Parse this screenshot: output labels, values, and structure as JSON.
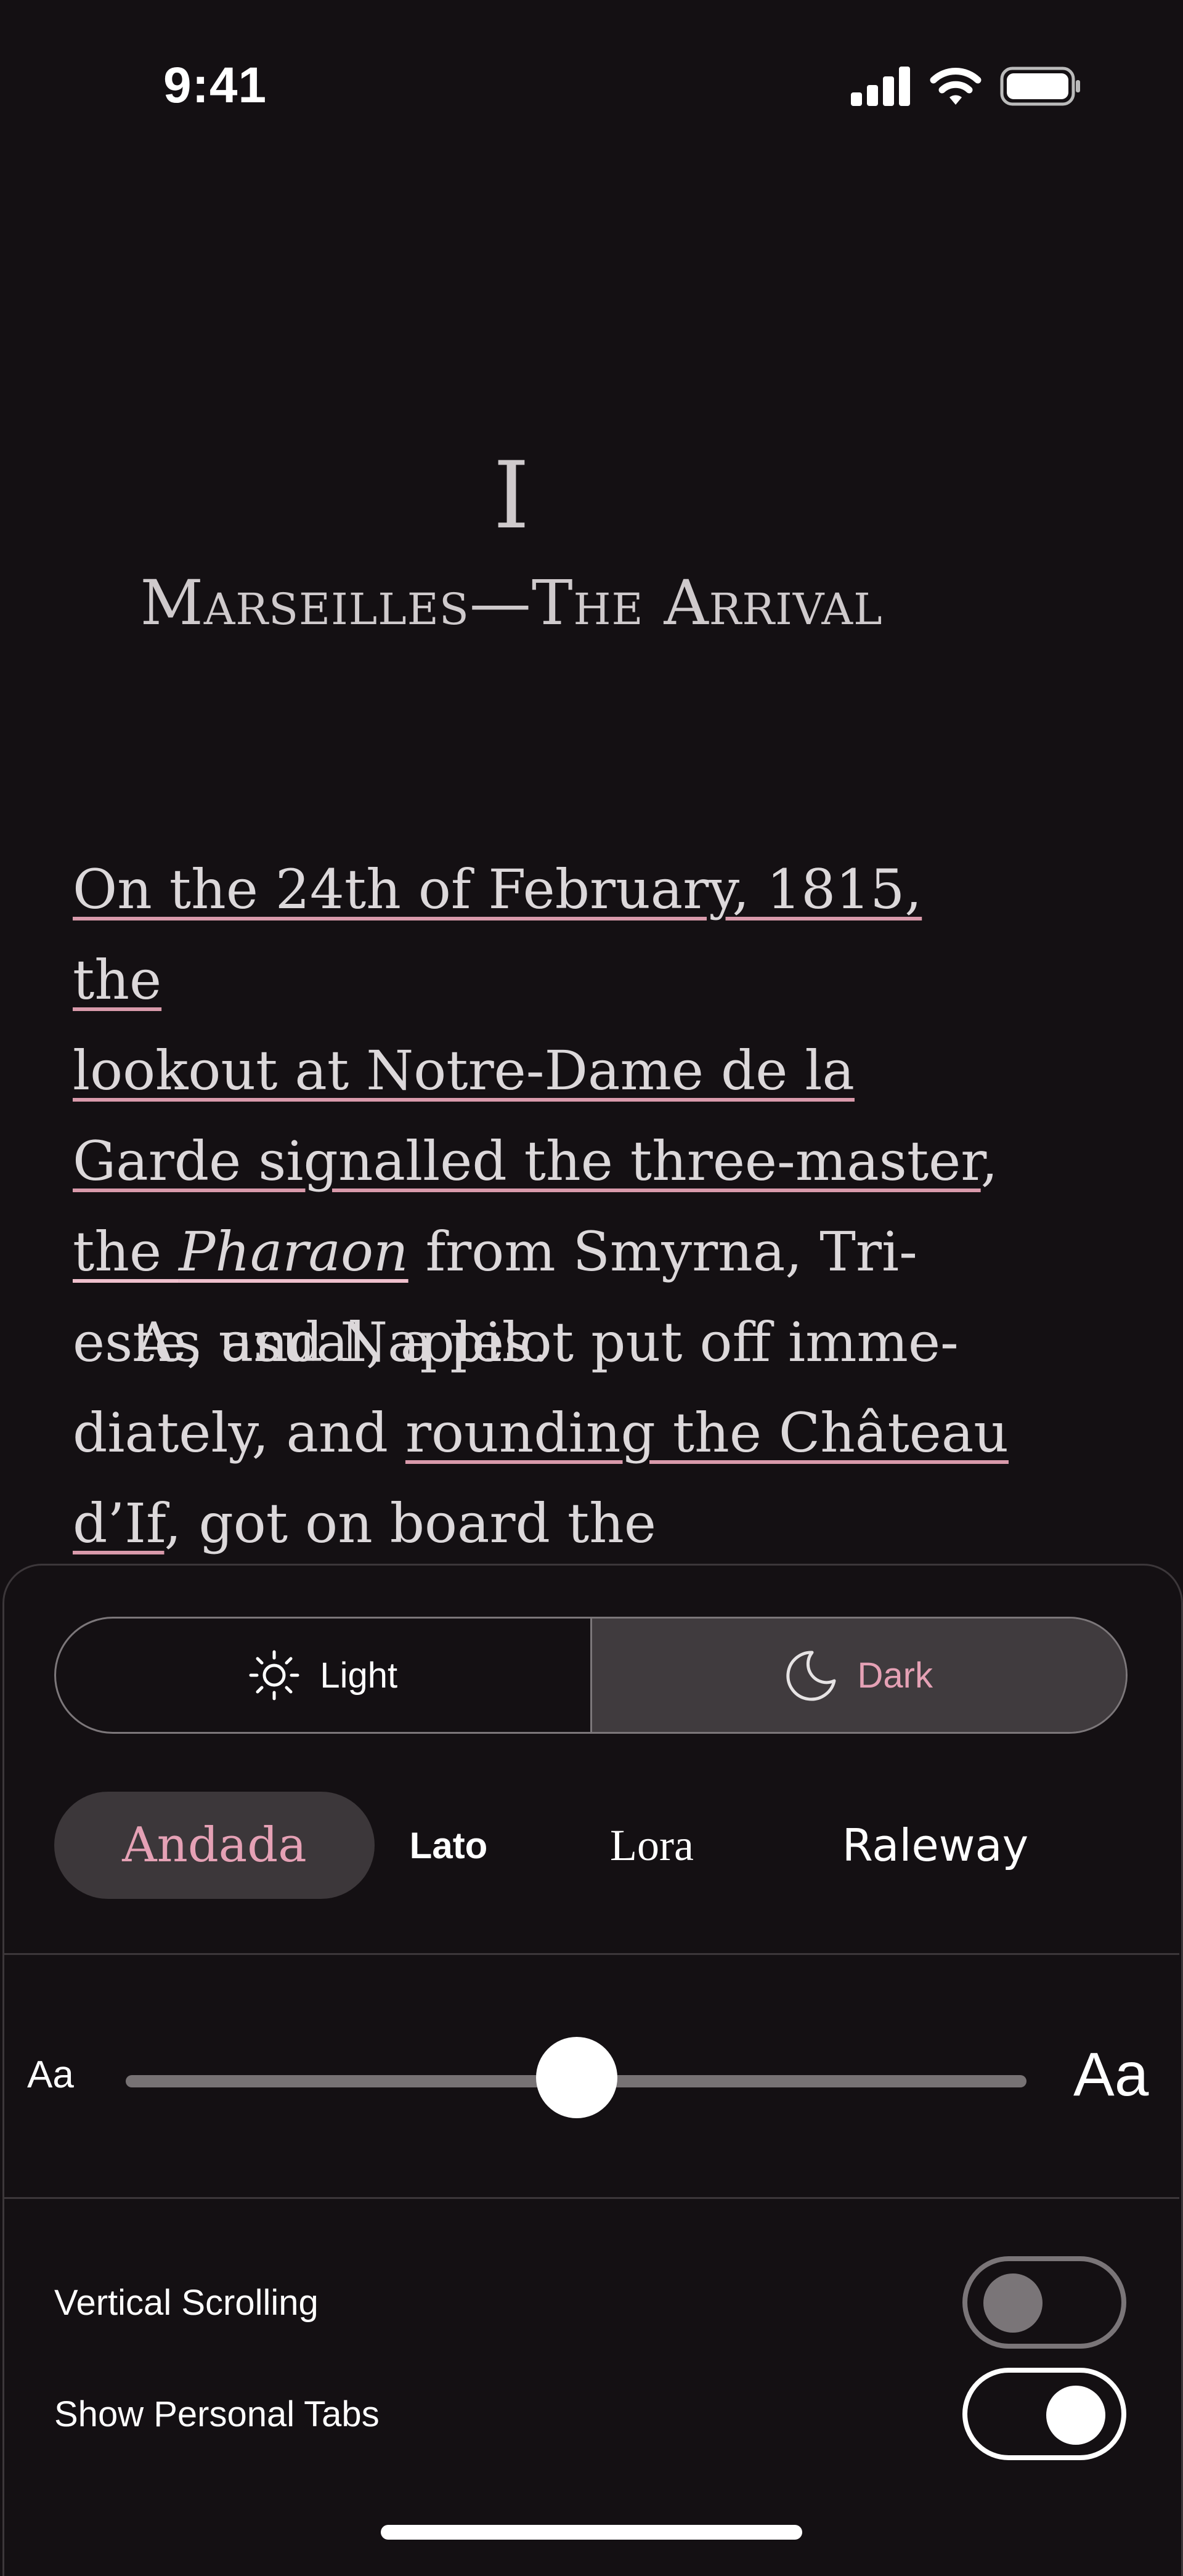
{
  "status_bar": {
    "time": "9:41",
    "icons": [
      "cellular-signal-icon",
      "wifi-icon",
      "battery-icon"
    ]
  },
  "chapter": {
    "number": "I",
    "title": "Marseilles—The Arrival",
    "p1": {
      "hl1": "On the 24th of February, 1815, the",
      "hl2": "lookout at Notre-Dame de la",
      "hl3": "Garde signalled the three-master",
      "comma": ",",
      "hl4_pre": "the ",
      "hl4_em": "Pharaon",
      "rest": " from Smyrna, Tri-este, and Naples."
    },
    "p2": {
      "text1": "As usual, a pilot put off imme-diately, and ",
      "hl5": "rounding the Château d’If",
      "text2": ", got on board the"
    }
  },
  "settings": {
    "theme": {
      "light_label": "Light",
      "dark_label": "Dark",
      "selected": "Dark"
    },
    "fonts": {
      "options": [
        "Andada",
        "Lato",
        "Lora",
        "Raleway"
      ],
      "selected": "Andada"
    },
    "text_size": {
      "small_label": "Aa",
      "large_label": "Aa",
      "value": 0.5
    },
    "toggles": [
      {
        "label": "Vertical Scrolling",
        "on": false
      },
      {
        "label": "Show Personal Tabs",
        "on": true
      }
    ]
  },
  "colors": {
    "background": "#141013",
    "accent_pink": "#e5a1b5",
    "highlight_underline": "#d99aab",
    "selected_fill": "#3c373a"
  }
}
